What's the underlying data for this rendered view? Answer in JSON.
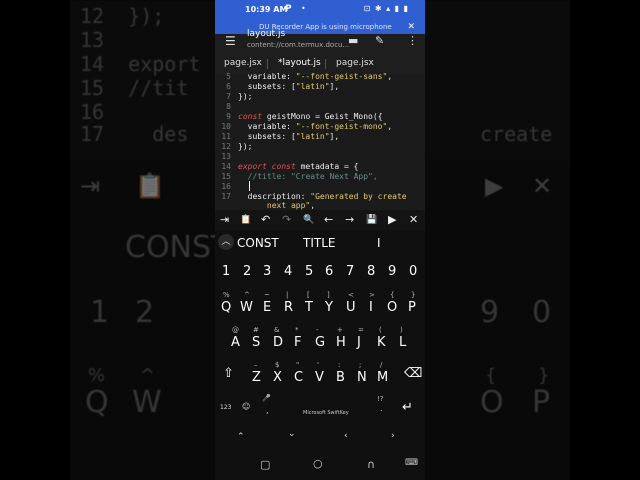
{
  "status_bar": {
    "time": "10:39 AM",
    "app_icon": "P",
    "dot": "•",
    "icons": "⊡ ✱ ▴ ▮ ▮"
  },
  "notification": {
    "text": "DU Recorder App is using microphone",
    "close": "✕"
  },
  "app_bar": {
    "title": "layout.js",
    "subtitle": "content://com.termux.docu...",
    "menu_icon": "hamburger-icon",
    "folder_icon": "folder-icon",
    "edit_icon": "pencil-icon",
    "more_icon": "more-vertical-icon"
  },
  "tabs": [
    "page.jsx",
    "*layout.js",
    "page.jsx"
  ],
  "active_tab": 1,
  "editor": {
    "lines": [
      {
        "n": "5",
        "c": "  variable: \"--font-geist-sans\","
      },
      {
        "n": "6",
        "c": "  subsets: [\"latin\"],"
      },
      {
        "n": "7",
        "c": "});"
      },
      {
        "n": "8",
        "c": ""
      },
      {
        "n": "9",
        "c": "const geistMono = Geist_Mono({"
      },
      {
        "n": "10",
        "c": "  variable: \"--font-geist-mono\","
      },
      {
        "n": "11",
        "c": "  subsets: [\"latin\"],"
      },
      {
        "n": "12",
        "c": "});"
      },
      {
        "n": "13",
        "c": ""
      },
      {
        "n": "14",
        "c": "export const metadata = {"
      },
      {
        "n": "15",
        "c": "  //title: \"Create Next App\","
      },
      {
        "n": "16",
        "c": ""
      },
      {
        "n": "17",
        "c": "  description: \"Generated by create"
      },
      {
        "n": "",
        "c": "      next app\","
      }
    ]
  },
  "extra_keys": [
    "⇥",
    "📋",
    "↶",
    "↷",
    "🔍",
    "←",
    "→",
    "💾",
    "▶",
    "✕"
  ],
  "keyboard": {
    "suggestions": [
      "CONST",
      "TITLE",
      "I"
    ],
    "numbers": [
      "1",
      "2",
      "3",
      "4",
      "5",
      "6",
      "7",
      "8",
      "9",
      "0"
    ],
    "row1": [
      "Q",
      "W",
      "E",
      "R",
      "T",
      "Y",
      "U",
      "I",
      "O",
      "P"
    ],
    "row1_hints": [
      "%",
      "^",
      "~",
      "|",
      "[",
      "]",
      "<",
      ">",
      "{",
      "}"
    ],
    "row2": [
      "A",
      "S",
      "D",
      "F",
      "G",
      "H",
      "J",
      "K",
      "L"
    ],
    "row2_hints": [
      "@",
      "#",
      "&",
      "*",
      "-",
      "+",
      "=",
      "(",
      ")"
    ],
    "row3": [
      "Z",
      "X",
      "C",
      "V",
      "B",
      "N",
      "M"
    ],
    "row3_hints": [
      "–",
      "$",
      "\"",
      "'",
      ":",
      ";",
      "/"
    ],
    "shift": "⇧",
    "backspace": "⌫",
    "num_key": "123",
    "emoji": "☺",
    "mic": "🎤",
    "comma": ",",
    "space_label": "Microsoft SwiftKey",
    "period_hints": "!?",
    "period": ".",
    "enter": "↵",
    "nav_keys": [
      "⌃",
      "⌄",
      "‹",
      "›",
      "⌄"
    ],
    "system_nav": [
      "▢",
      "○",
      "∩",
      "⌨"
    ]
  },
  "background": {
    "lines": [
      "12  });",
      "13  ",
      "14  export",
      "15  //tit",
      "16  ",
      "17    des"
    ],
    "create_text": "create",
    "kb_suggest": "CONST",
    "kb_numbers": [
      "1",
      "2",
      "9",
      "0"
    ],
    "kb_letters": [
      "Q",
      "W",
      "O",
      "P"
    ],
    "kb_symbols": [
      "%",
      "^",
      "{",
      "}"
    ]
  }
}
